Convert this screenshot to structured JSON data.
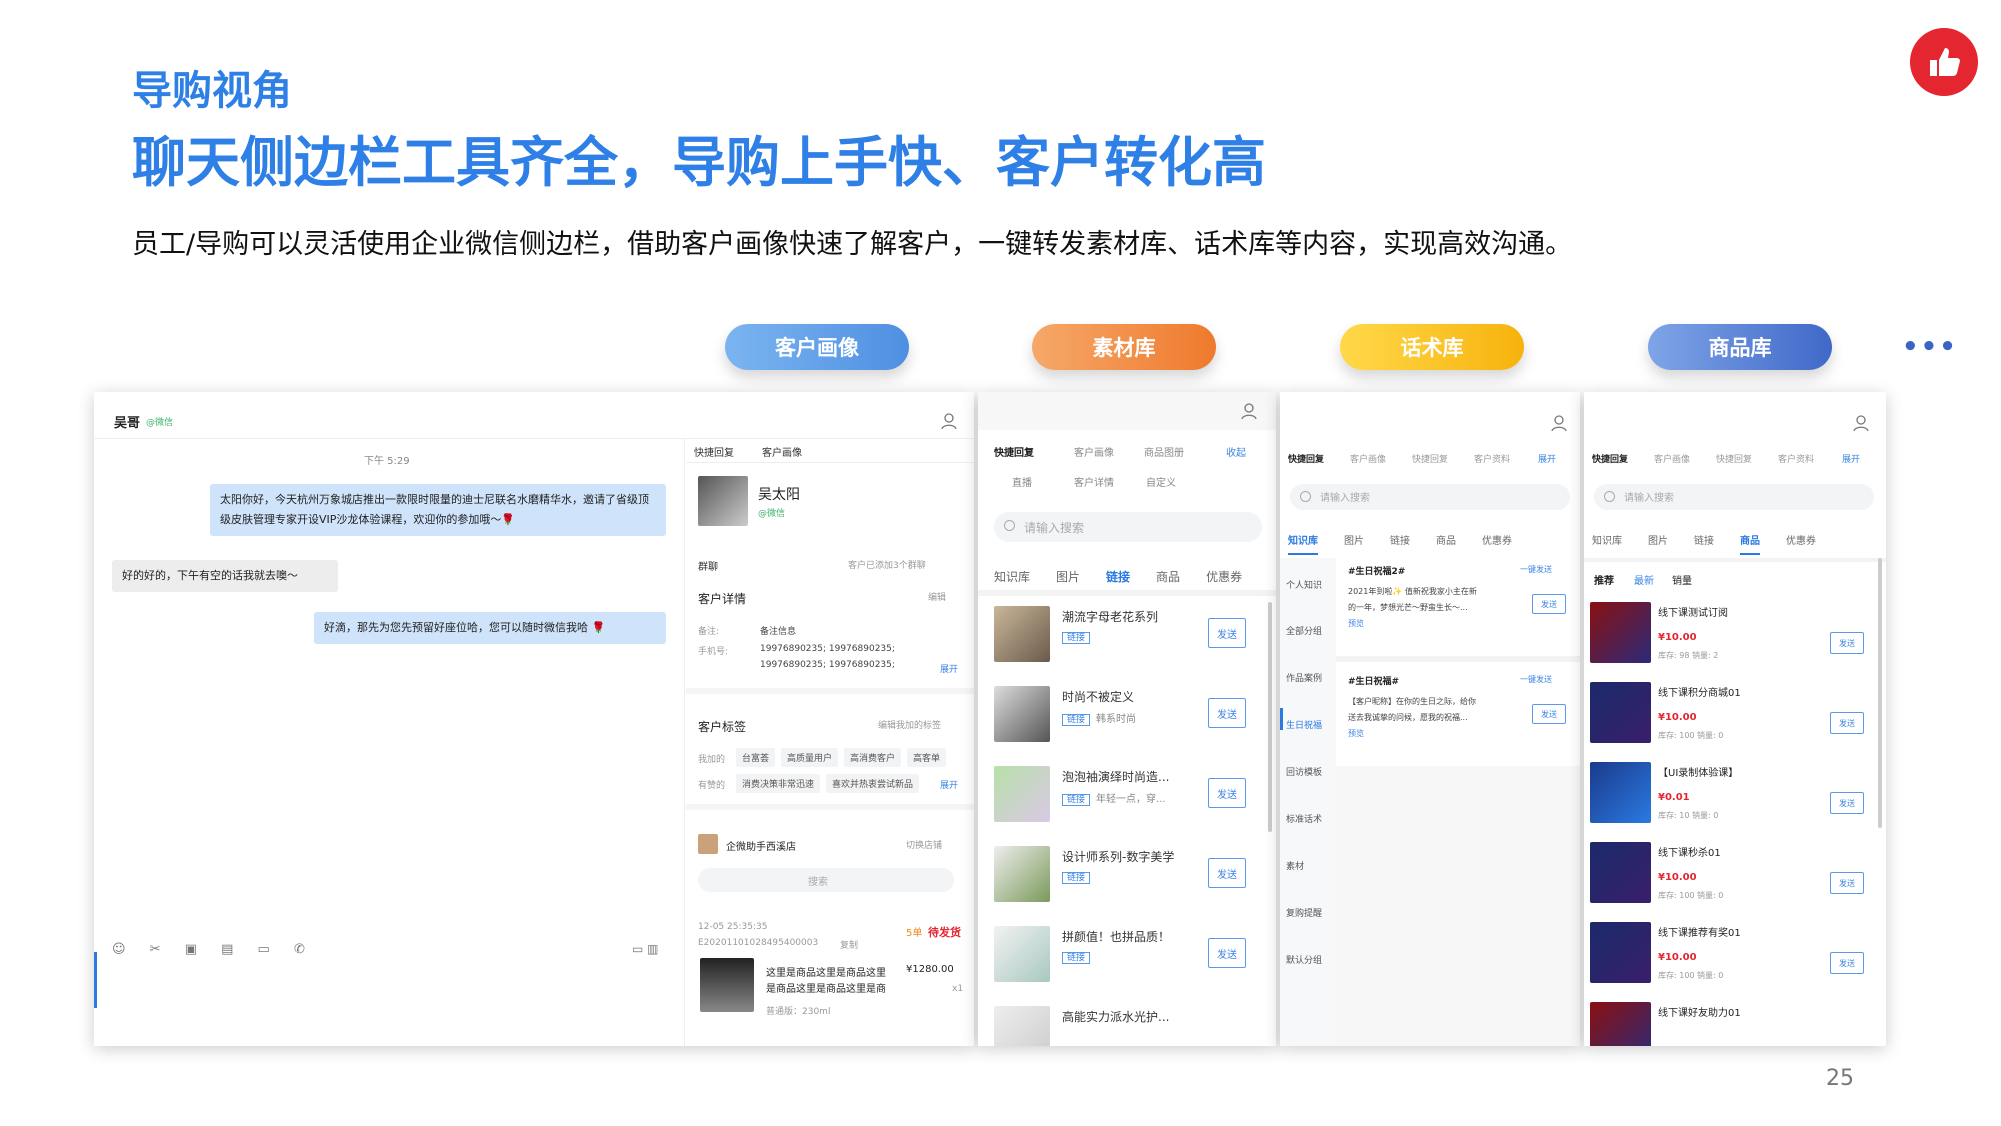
{
  "slide": {
    "kicker": "导购视角",
    "headline": "聊天侧边栏工具齐全，导购上手快、客户转化高",
    "intro": "员工/导购可以灵活使用企业微信侧边栏，借助客户画像快速了解客户，一键转发素材库、话术库等内容，实现高效沟通。",
    "page_number": "25",
    "more": "•••",
    "brand_color": "#2e7fe6"
  },
  "feature_tabs": [
    "客户画像",
    "素材库",
    "话术库",
    "商品库"
  ],
  "chat": {
    "contact_name": "吴哥",
    "contact_source": "@微信",
    "time": "下午 5:29",
    "messages": [
      {
        "side": "right",
        "text": "太阳你好，今天杭州万象城店推出一款限时限量的迪士尼联名水磨精华水，邀请了省级顶级皮肤管理专家开设VIP沙龙体验课程，欢迎你的参加哦～🌹"
      },
      {
        "side": "left",
        "text": "好的好的，下午有空的话我就去噢～"
      },
      {
        "side": "right",
        "text": "好滴，那先为您先预留好座位哈，您可以随时微信我哈 🌹"
      }
    ]
  },
  "portrait": {
    "tabs": [
      "快捷回复",
      "客户画像"
    ],
    "customer_name": "吴太阳",
    "customer_source": "@微信",
    "group_label": "群聊",
    "group_value": "客户已添加3个群聊",
    "details_label": "客户详情",
    "edit": "编辑",
    "remark_label": "备注:",
    "remark_value": "备注信息",
    "phone_label": "手机号:",
    "phone_line1": "19976890235;  19976890235;",
    "phone_line2": "19976890235;  19976890235;",
    "expand": "展开",
    "tags_label": "客户标签",
    "tags_edit": "编辑我加的标签",
    "my_tags_label": "我加的",
    "my_tags": [
      "台富荟",
      "高质量用户",
      "高消费客户",
      "高客单"
    ],
    "shared_tags_label": "有赞的",
    "shared_tags": [
      "消费决策非常迅速",
      "喜欢并热衷尝试新品"
    ],
    "shop_name": "企微助手西溪店",
    "switch_shop": "切换店铺",
    "search_placeholder": "搜索",
    "order_time": "12-05 25:35:35",
    "order_no": "E20201101028495400003",
    "copy": "复制",
    "order_count": "5单",
    "order_status": "待发货",
    "product_title_line1": "这里是商品这里是商品这里",
    "product_title_line2": "是商品这里是商品这里是商",
    "product_price": "¥1280.00",
    "product_qty": "x1",
    "product_spec": "普通版：230ml"
  },
  "material": {
    "tabs_row1": [
      "快捷回复",
      "客户画像",
      "商品图册",
      "收起"
    ],
    "tabs_row2": [
      "直播",
      "客户详情",
      "自定义"
    ],
    "search_placeholder": "请输入搜索",
    "category_tabs": [
      "知识库",
      "图片",
      "链接",
      "商品",
      "优惠券"
    ],
    "active_tab": "链接",
    "link_tag": "链接",
    "send": "发送",
    "items": [
      {
        "title": "潮流字母老花系列",
        "sub": ""
      },
      {
        "title": "时尚不被定义",
        "sub": "韩系时尚"
      },
      {
        "title": "泡泡袖演绎时尚造...",
        "sub": "年轻一点，穿..."
      },
      {
        "title": "设计师系列-数字美学",
        "sub": ""
      },
      {
        "title": "拼颜值！也拼品质！",
        "sub": ""
      },
      {
        "title": "高能实力派水光护...",
        "sub": ""
      }
    ]
  },
  "script_lib": {
    "tabs": [
      "快捷回复",
      "客户画像",
      "快捷回复",
      "客户资料",
      "展开"
    ],
    "search_placeholder": "请输入搜索",
    "category_tabs": [
      "知识库",
      "图片",
      "链接",
      "商品",
      "优惠券"
    ],
    "side_categories": [
      "个人知识",
      "全部分组",
      "作品案例",
      "生日祝福",
      "回访模板",
      "标准话术",
      "素材",
      "复购提醒",
      "默认分组"
    ],
    "send_all": "一键发送",
    "send": "发送",
    "preview": "预览",
    "cards": [
      {
        "title": "#生日祝福2#",
        "line1": "2021年到啦✨ 值新祝我家小主在新",
        "line2": "的一年，梦想光芒～野蛮生长～..."
      },
      {
        "title": "#生日祝福#",
        "line1": "【客户昵称】在你的生日之际，给你",
        "line2": "送去我诚挚的问候，愿我的祝福..."
      }
    ]
  },
  "product_lib": {
    "tabs": [
      "快捷回复",
      "客户画像",
      "快捷回复",
      "客户资料",
      "展开"
    ],
    "search_placeholder": "请输入搜索",
    "category_tabs": [
      "知识库",
      "图片",
      "链接",
      "商品",
      "优惠券"
    ],
    "sort_tabs": [
      "推荐",
      "最新",
      "销量"
    ],
    "send": "发送",
    "products": [
      {
        "name": "线下课测试订阅",
        "price": "¥10.00",
        "stock": "库存: 98   销量: 2"
      },
      {
        "name": "线下课积分商城01",
        "price": "¥10.00",
        "stock": "库存: 100   销量: 0"
      },
      {
        "name": "【UI录制体验课】",
        "price": "¥0.01",
        "stock": "库存: 10   销量: 0"
      },
      {
        "name": "线下课秒杀01",
        "price": "¥10.00",
        "stock": "库存: 100   销量: 0"
      },
      {
        "name": "线下课推荐有奖01",
        "price": "¥10.00",
        "stock": "库存: 100   销量: 0"
      },
      {
        "name": "线下课好友助力01",
        "price": "",
        "stock": ""
      }
    ]
  }
}
